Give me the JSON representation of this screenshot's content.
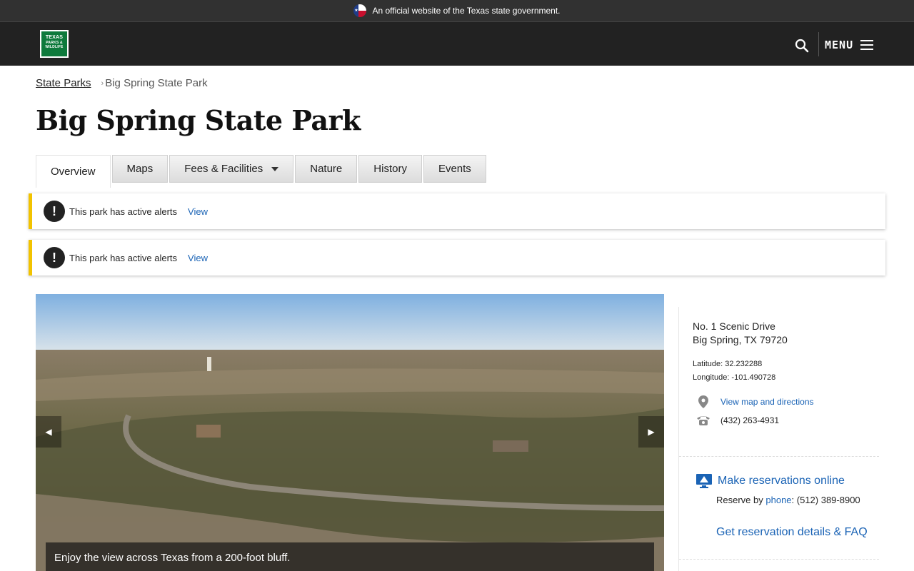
{
  "official_bar": {
    "text": "An official website of the Texas state government."
  },
  "header": {
    "logo": {
      "line1": "TEXAS",
      "line2": "PARKS &",
      "line3": "WILDLIFE"
    },
    "menu_label": "MENU"
  },
  "breadcrumb": {
    "parent": "State Parks",
    "current": "Big Spring State Park"
  },
  "page_title": "Big Spring State Park",
  "tabs": [
    {
      "label": "Overview",
      "active": true
    },
    {
      "label": "Maps"
    },
    {
      "label": "Fees & Facilities",
      "dropdown": true
    },
    {
      "label": "Nature"
    },
    {
      "label": "History"
    },
    {
      "label": "Events"
    }
  ],
  "alerts": [
    {
      "message": "This park has active alerts",
      "link": "View"
    },
    {
      "message": "This park has active alerts",
      "link": "View"
    }
  ],
  "photo": {
    "caption": "Enjoy the view across Texas from a 200-foot bluff.",
    "prev": "◀",
    "next": "▶"
  },
  "sidebar": {
    "address_line1": "No. 1 Scenic Drive",
    "address_line2": "Big Spring, TX 79720",
    "latitude": "Latitude: 32.232288",
    "longitude": "Longitude: -101.490728",
    "map_link": "View map and directions",
    "phone": "(432) 263-4931",
    "reservations": {
      "online_link": "Make reservations online",
      "reserve_by": "Reserve by ",
      "phone_link": "phone",
      "phone_number": ": (512) 389-8900",
      "faq_link": "Get reservation details & FAQ"
    }
  },
  "colors": {
    "header_bg": "#222222",
    "official_bg": "#313131",
    "link": "#1a63b5",
    "alert_accent": "#f2c300",
    "logo_green": "#0e7a3c"
  }
}
